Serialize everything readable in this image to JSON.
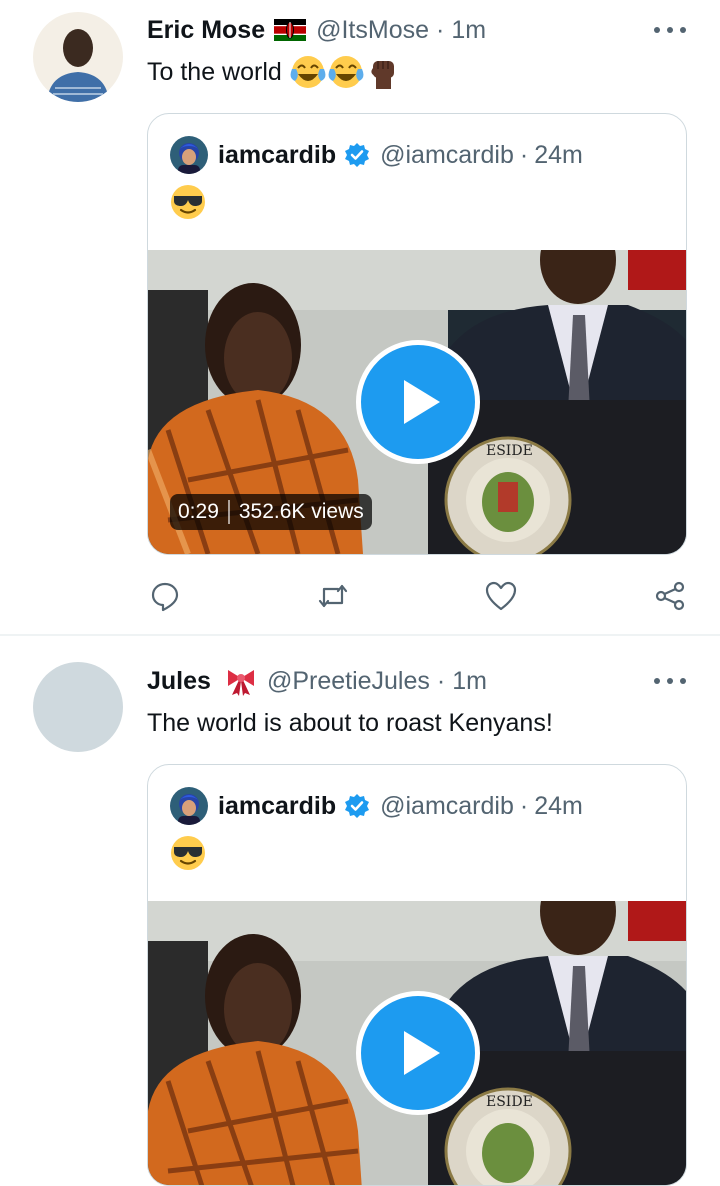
{
  "tweets": [
    {
      "author_name": "Eric Mose",
      "author_flag": "kenya-flag",
      "author_handle": "@ItsMose",
      "separator": "·",
      "time": "1m",
      "text": "To the world",
      "text_emojis": [
        "face-with-tears-of-joy",
        "face-with-tears-of-joy",
        "raised-fist-dark-skin"
      ],
      "quote": {
        "author_name": "iamcardib",
        "author_handle": "@iamcardib",
        "separator": "·",
        "time": "24m",
        "emoji": "smiling-face-with-sunglasses",
        "media": {
          "duration": "0:29",
          "views": "352.6K views"
        }
      },
      "actions": [
        "reply-icon",
        "retweet-icon",
        "like-icon",
        "share-icon"
      ]
    },
    {
      "author_name": "Jules",
      "author_emoji": "ribbon",
      "author_handle": "@PreetieJules",
      "separator": "·",
      "time": "1m",
      "text": "The world is about to roast Kenyans!",
      "quote": {
        "author_name": "iamcardib",
        "author_handle": "@iamcardib",
        "separator": "·",
        "time": "24m",
        "emoji": "smiling-face-with-sunglasses"
      }
    }
  ],
  "colors": {
    "accent": "#1d9bf0",
    "text": "#0f1419",
    "secondary": "#536471",
    "border": "#cfd9de"
  }
}
